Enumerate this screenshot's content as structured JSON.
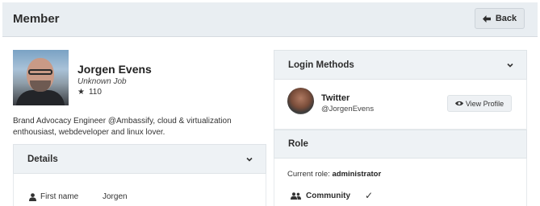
{
  "header": {
    "title": "Member",
    "back_label": "Back"
  },
  "profile": {
    "name": "Jorgen Evens",
    "job": "Unknown Job",
    "points": "110",
    "bio": "Brand Advocacy Engineer @Ambassify, cloud & virtualization enthousiast, webdeveloper and linux lover."
  },
  "details": {
    "title": "Details",
    "fields": [
      {
        "icon": "person-icon",
        "label": "First name",
        "value": "Jorgen"
      }
    ]
  },
  "login_methods": {
    "title": "Login Methods",
    "items": [
      {
        "provider": "Twitter",
        "handle": "@JorgenEvens",
        "action_label": "View Profile",
        "action_icon": "eye-icon"
      }
    ]
  },
  "role": {
    "title": "Role",
    "current_label": "Current role:",
    "current_value": "administrator",
    "group": {
      "icon": "users-icon",
      "label": "Community",
      "check": "✓"
    }
  },
  "colors": {
    "header_bg": "#e9eef2",
    "panel_head_bg": "#eef2f5",
    "button_bg": "#e3e8ec"
  }
}
